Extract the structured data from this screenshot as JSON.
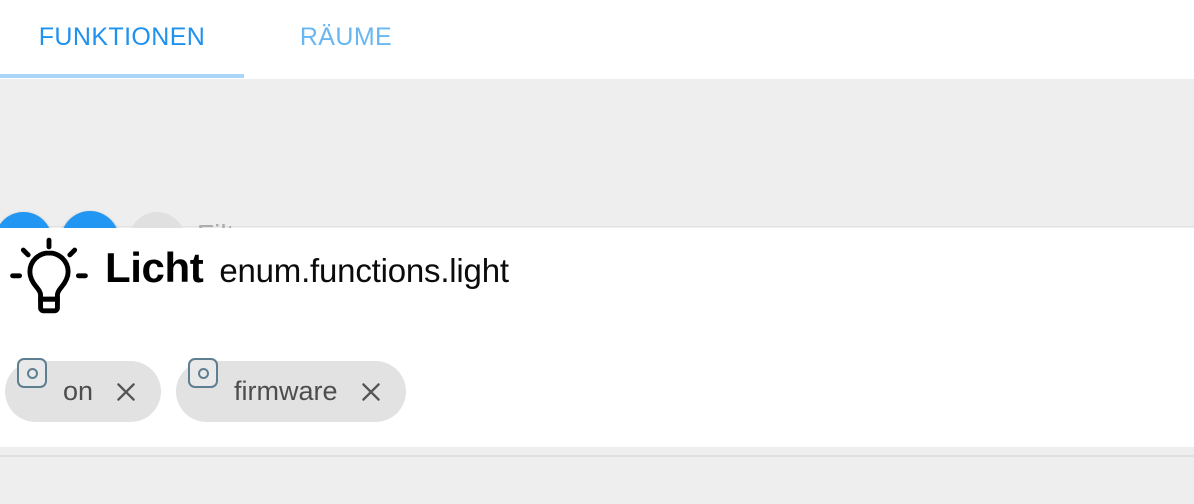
{
  "tabs": [
    {
      "id": "functions",
      "label": "FUNKTIONEN",
      "active": true
    },
    {
      "id": "rooms",
      "label": "RÄUME",
      "active": false
    }
  ],
  "toolbar": {
    "add_button": {
      "label": "",
      "icon": "library-add-icon",
      "enabled": true
    },
    "edit_button": {
      "label": "",
      "icon": "pencil-icon",
      "enabled": true
    },
    "delete_button": {
      "label": "",
      "icon": "trash-icon",
      "enabled": false
    },
    "filter": {
      "placeholder": "Filter",
      "value": ""
    }
  },
  "enum": {
    "icon": "lightbulb-icon",
    "name": "Licht",
    "id": "enum.functions.light",
    "members": [
      {
        "label": "on",
        "icon": "state-circle-icon",
        "close_icon": "close-icon"
      },
      {
        "label": "firmware",
        "icon": "state-circle-icon",
        "close_icon": "close-icon"
      }
    ]
  },
  "colors": {
    "accent": "#2196f3",
    "tab_active": "#1f91ef",
    "tab_inactive": "#68b7f3",
    "tab_indicator": "#a8d5f8",
    "toolbar_bg": "#eeeeee",
    "card_bg": "#ffffff",
    "chip_bg": "#e2e2e2",
    "chip_badge": "#5d7f91",
    "disabled_fab": "#e0e0e0",
    "placeholder": "#adadad"
  }
}
